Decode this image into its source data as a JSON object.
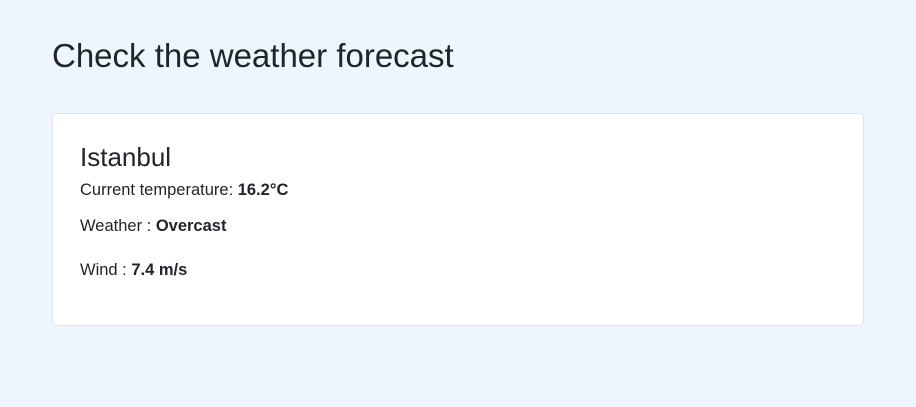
{
  "page": {
    "title": "Check the weather forecast"
  },
  "weather_card": {
    "city": "Istanbul",
    "temperature": {
      "label": "Current temperature: ",
      "value": "16.2°C"
    },
    "condition": {
      "label": "Weather : ",
      "value": "Overcast"
    },
    "wind": {
      "label": "Wind : ",
      "value": "7.4 m/s"
    }
  },
  "colors": {
    "page_background": "#eef6fd",
    "card_background": "#ffffff",
    "card_border": "#dfe3e7",
    "text": "#212529"
  }
}
